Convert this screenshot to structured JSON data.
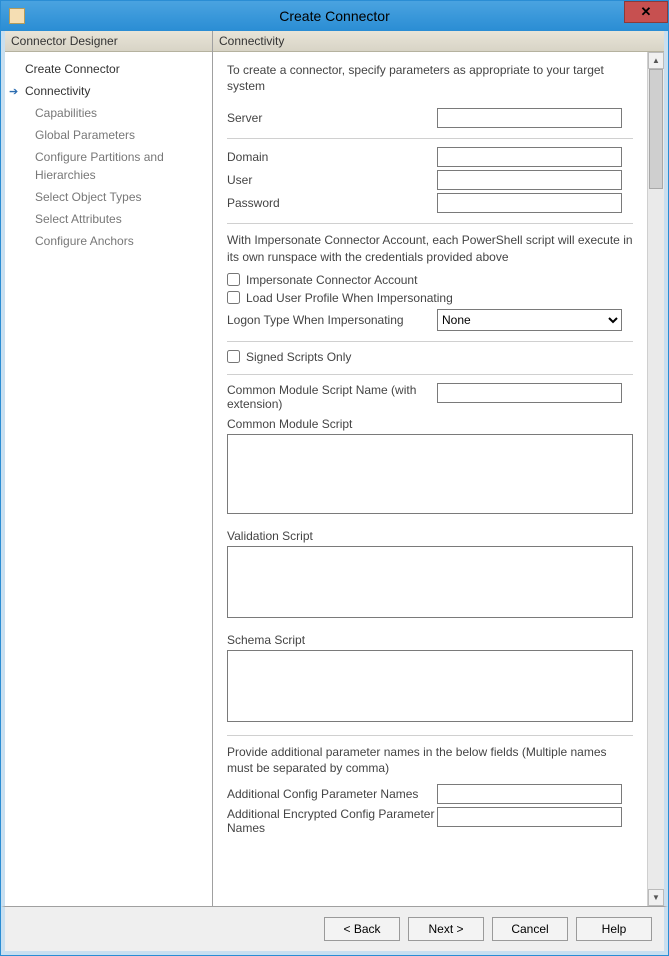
{
  "window": {
    "title": "Create Connector"
  },
  "sidebar": {
    "header": "Connector Designer",
    "items": [
      {
        "label": "Create Connector"
      },
      {
        "label": "Connectivity"
      },
      {
        "label": "Capabilities"
      },
      {
        "label": "Global Parameters"
      },
      {
        "label": "Configure Partitions and Hierarchies"
      },
      {
        "label": "Select Object Types"
      },
      {
        "label": "Select Attributes"
      },
      {
        "label": "Configure Anchors"
      }
    ]
  },
  "main": {
    "header": "Connectivity",
    "intro": "To create a connector, specify parameters as appropriate to your target system",
    "fields": {
      "server_label": "Server",
      "server_value": "",
      "domain_label": "Domain",
      "domain_value": "",
      "user_label": "User",
      "user_value": "",
      "password_label": "Password",
      "password_value": ""
    },
    "impersonate_note": "With Impersonate Connector Account, each PowerShell script will execute in its own runspace with the credentials provided above",
    "checks": {
      "impersonate_label": "Impersonate Connector Account",
      "load_profile_label": "Load User Profile When Impersonating",
      "signed_only_label": "Signed Scripts Only"
    },
    "logon_type_label": "Logon Type When Impersonating",
    "logon_type_value": "None",
    "common_module_name_label": "Common Module Script Name (with extension)",
    "common_module_name_value": "",
    "common_module_script_label": "Common Module Script",
    "validation_script_label": "Validation Script",
    "schema_script_label": "Schema Script",
    "additional_note": "Provide additional parameter names in the below fields (Multiple names must be separated by comma)",
    "additional_config_label": "Additional Config Parameter Names",
    "additional_config_value": "",
    "additional_encrypted_label": "Additional Encrypted Config Parameter Names",
    "additional_encrypted_value": ""
  },
  "buttons": {
    "back": "<  Back",
    "next": "Next  >",
    "cancel": "Cancel",
    "help": "Help"
  }
}
